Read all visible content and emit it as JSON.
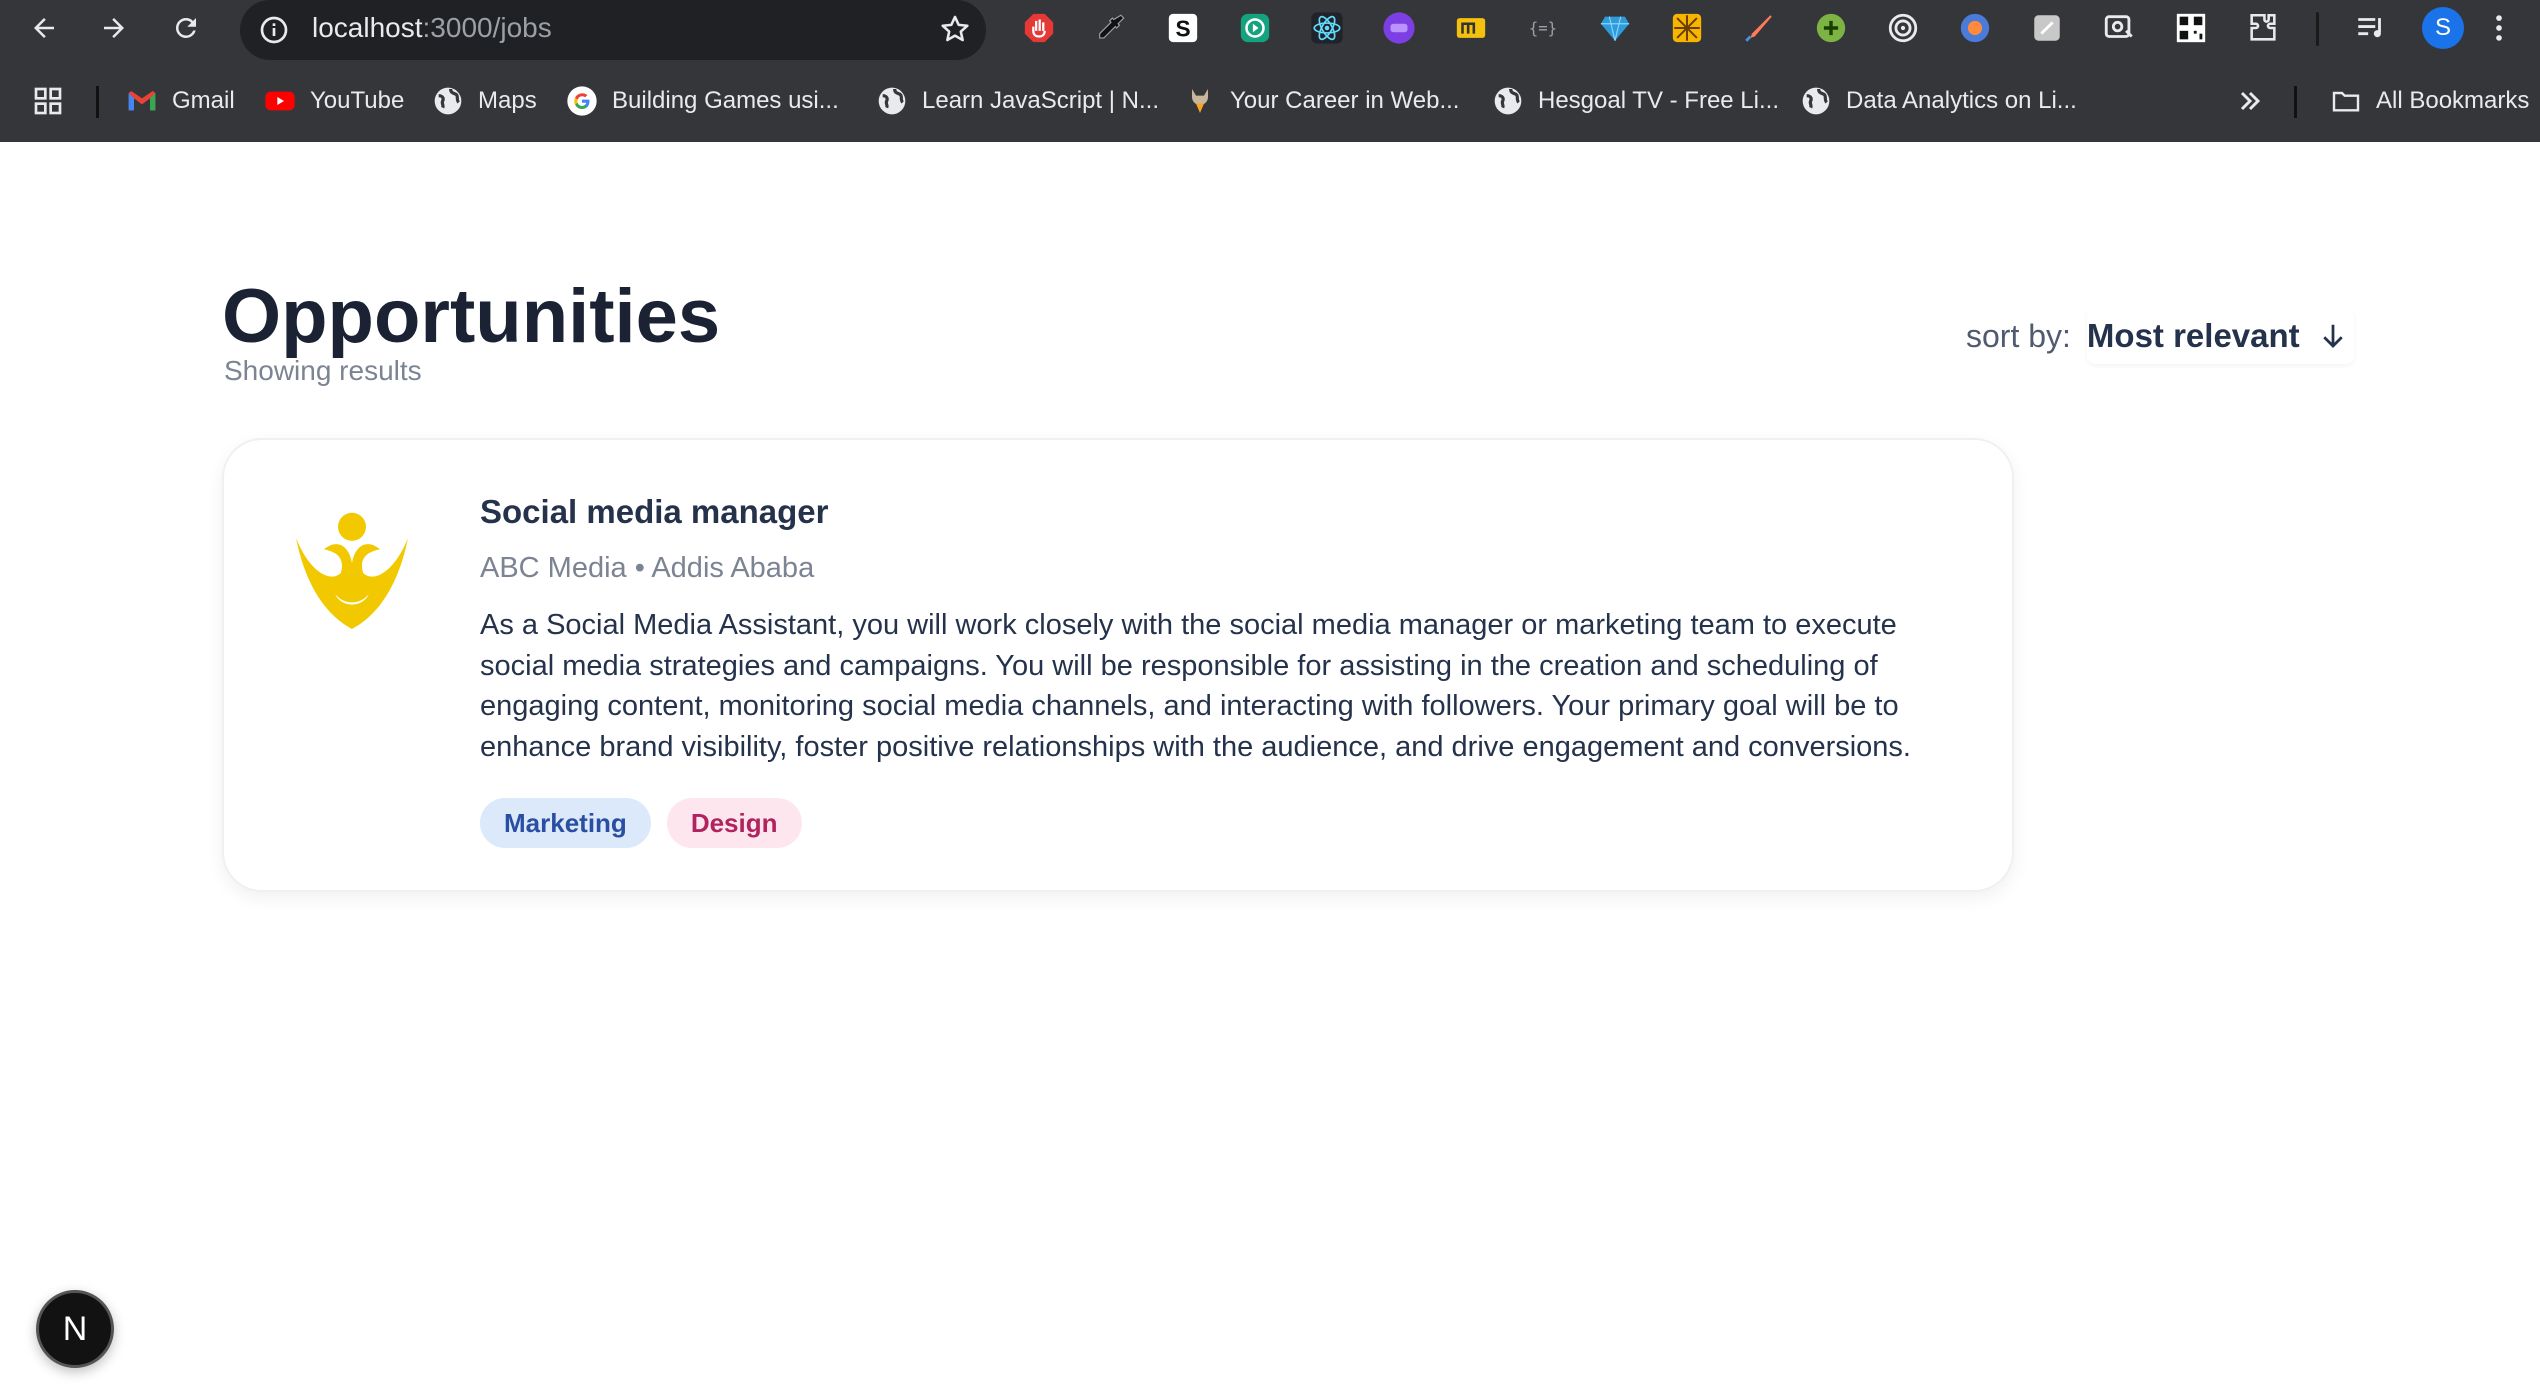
{
  "browser": {
    "url_host": "localhost",
    "url_path": ":3000/jobs",
    "profile_initial": "S",
    "bookmarks": [
      {
        "label": "Gmail",
        "icon": "gmail-icon"
      },
      {
        "label": "YouTube",
        "icon": "youtube-icon"
      },
      {
        "label": "Maps",
        "icon": "globe-icon"
      },
      {
        "label": "Building Games usi...",
        "icon": "google-icon"
      },
      {
        "label": "Learn JavaScript | N...",
        "icon": "globe-icon"
      },
      {
        "label": "Your Career in Web...",
        "icon": "career-icon"
      },
      {
        "label": "Hesgoal TV - Free Li...",
        "icon": "globe-icon"
      },
      {
        "label": "Data Analytics on Li...",
        "icon": "globe-icon"
      }
    ],
    "all_bookmarks": "All Bookmarks"
  },
  "page": {
    "title": "Opportunities",
    "subtitle": "Showing results",
    "sort_label": "sort by:",
    "sort_value": "Most relevant"
  },
  "jobs": [
    {
      "title": "Social media manager",
      "company": "ABC Media",
      "location": "Addis Ababa",
      "meta": "ABC Media • Addis Ababa",
      "description": "As a Social Media Assistant, you will work closely with the social media manager or marketing team to execute social media strategies and campaigns. You will be responsible for assisting in the creation and scheduling of engaging content, monitoring social media channels, and interacting with followers. Your primary goal will be to enhance brand visibility, foster positive relationships with the audience, and drive engagement and conversions.",
      "tags": [
        "Marketing",
        "Design"
      ],
      "logo_color": "#f2c900"
    }
  ],
  "dev_badge": "N"
}
